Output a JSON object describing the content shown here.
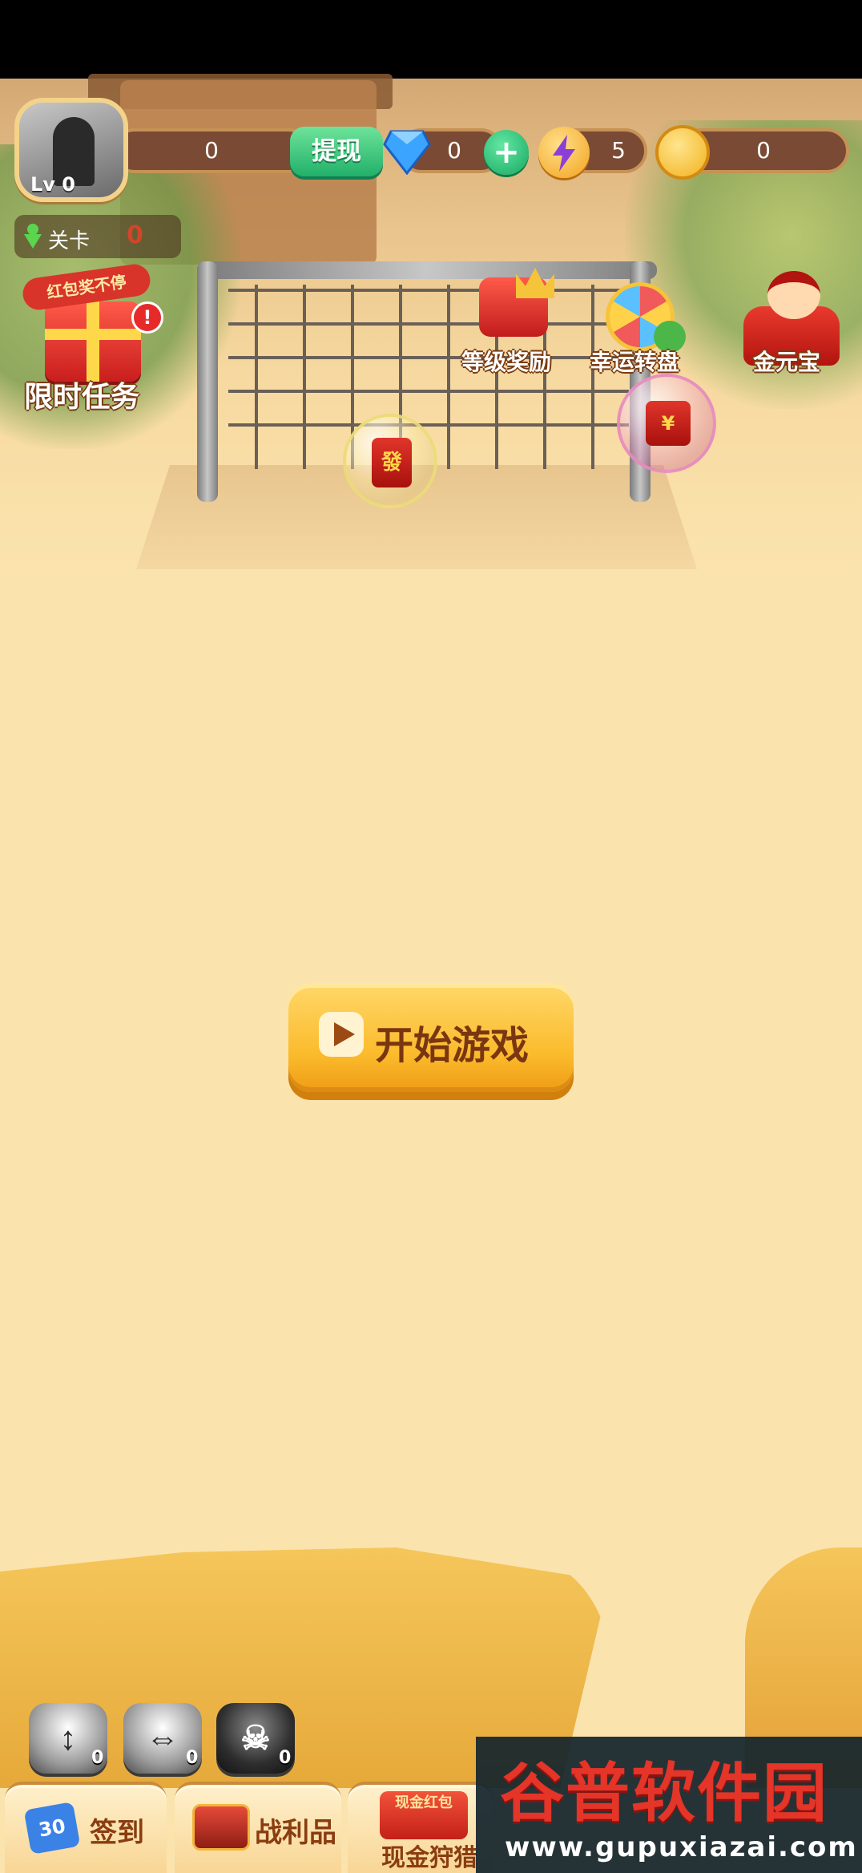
{
  "player": {
    "level_badge": "Lv 0",
    "score": "0",
    "stage_label": "关卡",
    "stage_value": "0"
  },
  "currency": {
    "withdraw_label": "提现",
    "diamonds": "0",
    "energy": "5",
    "coins": "0"
  },
  "features": {
    "timed_task_banner": "红包奖不停",
    "timed_task_label": "限时任务",
    "alert_mark": "!",
    "level_reward_label": "等级奖励",
    "lucky_wheel_label": "幸运转盘",
    "gold_ingot_label": "金元宝"
  },
  "bubbles": {
    "red_envelope_glyph": "發",
    "red_envelope_b_glyph": "¥"
  },
  "start": {
    "label": "开始游戏"
  },
  "tools": [
    {
      "name": "vertical-swap",
      "count": "0",
      "glyph": "↕"
    },
    {
      "name": "horizontal-swap",
      "count": "0",
      "glyph": "⇔"
    },
    {
      "name": "bomb",
      "count": "0",
      "glyph": "☠"
    }
  ],
  "bottom_menu": {
    "signin_badge": "30",
    "signin_label": "签到",
    "spoils_label": "战利品",
    "cash_hunt_tag": "现金红包",
    "cash_hunt_label": "现金狩猎"
  },
  "watermark": {
    "title": "谷普软件园",
    "url": "www.gupuxiazai.com"
  },
  "colors": {
    "background": "#fbe3ad",
    "start_button": "#fbbb2c",
    "withdraw_button": "#22b06a",
    "stage_value": "#d2452a"
  }
}
